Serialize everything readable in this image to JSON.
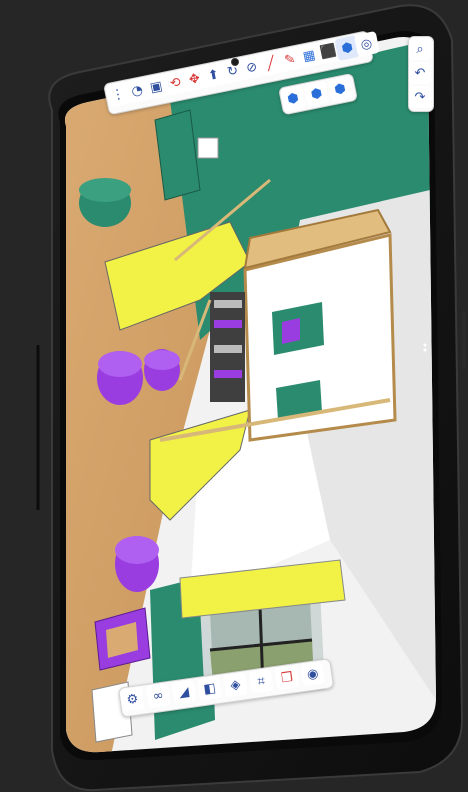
{
  "app": {
    "name": "3D modeling app on tablet",
    "accent_color": "#2a6ed9",
    "toolbar_color": "#fbfbfb"
  },
  "scene": {
    "floor_color": "#d7a86e",
    "wall_color": "#2a8b6e",
    "accent_yellow": "#f2f246",
    "accent_purple": "#9a3de0",
    "wood_color": "#e4c48c"
  },
  "top_toolbar": {
    "buttons": [
      {
        "icon": "more-vertical-icon",
        "glyph": "⋮"
      },
      {
        "icon": "paint-bucket-icon",
        "glyph": "◔"
      },
      {
        "icon": "component-icon",
        "glyph": "▣"
      },
      {
        "icon": "orbit-icon",
        "glyph": "⟲"
      },
      {
        "icon": "move-icon",
        "glyph": "✥"
      },
      {
        "icon": "push-pull-icon",
        "glyph": "⬆"
      },
      {
        "icon": "rotate-icon",
        "glyph": "↻"
      },
      {
        "icon": "tape-measure-icon",
        "glyph": "⊘"
      },
      {
        "icon": "line-icon",
        "glyph": "╱"
      },
      {
        "icon": "pencil-icon",
        "glyph": "✎"
      },
      {
        "icon": "save-icon",
        "glyph": "▦"
      },
      {
        "icon": "box-tool-icon",
        "glyph": "⬛"
      },
      {
        "icon": "section-plane-icon",
        "glyph": "⬢"
      },
      {
        "icon": "spiral-icon",
        "glyph": "◎"
      }
    ],
    "sub_buttons": [
      {
        "icon": "section-cut-icon",
        "glyph": "⬢"
      },
      {
        "icon": "section-fill-icon",
        "glyph": "⬢"
      },
      {
        "icon": "section-display-icon",
        "glyph": "⬢"
      }
    ]
  },
  "right_rail": {
    "buttons": [
      {
        "icon": "search-icon",
        "glyph": "⌕"
      },
      {
        "icon": "undo-icon",
        "glyph": "↶"
      },
      {
        "icon": "redo-icon",
        "glyph": "↷"
      }
    ]
  },
  "bottom_toolbar": {
    "buttons": [
      {
        "icon": "settings-icon",
        "glyph": "⚙"
      },
      {
        "icon": "layers-icon",
        "glyph": "∞"
      },
      {
        "icon": "eraser-icon",
        "glyph": "◢"
      },
      {
        "icon": "materials-icon",
        "glyph": "◧"
      },
      {
        "icon": "cube-icon",
        "glyph": "◈"
      },
      {
        "icon": "selection-icon",
        "glyph": "⌗"
      },
      {
        "icon": "outliner-icon",
        "glyph": "❒"
      },
      {
        "icon": "camera-icon",
        "glyph": "◉"
      }
    ]
  }
}
